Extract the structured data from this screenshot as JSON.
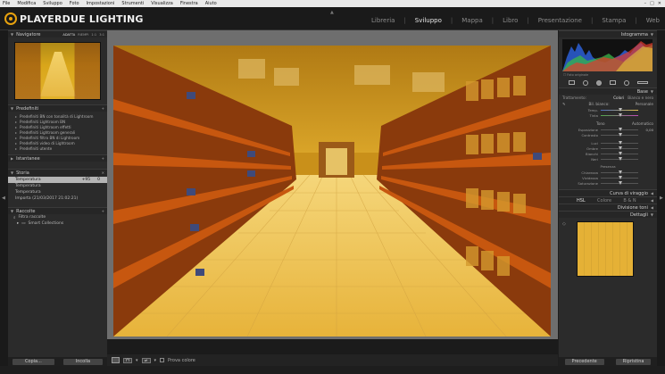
{
  "menubar": {
    "items": [
      "File",
      "Modifica",
      "Sviluppo",
      "Foto",
      "Impostazioni",
      "Strumenti",
      "Visualizza",
      "Finestra",
      "Aiuto"
    ]
  },
  "logo": {
    "text": "PLAYERDUE LIGHTING"
  },
  "modules": {
    "items": [
      "Libreria",
      "Sviluppo",
      "Mappa",
      "Libro",
      "Presentazione",
      "Stampa",
      "Web"
    ],
    "active": "Sviluppo"
  },
  "navigator": {
    "title": "Navigatore",
    "zoom_options": [
      "ADATTA",
      "RIEMPI",
      "1:1",
      "3:1"
    ]
  },
  "presets": {
    "title": "Predefiniti",
    "items": [
      "Predefiniti BN con tonalità di Lightroom",
      "Predefiniti Lightroom BN",
      "Predefiniti Lightroom effetti",
      "Predefiniti Lightroom generali",
      "Predefiniti filtro BN di Lightroom",
      "Predefiniti video di Lightroom",
      "Predefiniti utente"
    ]
  },
  "snapshots": {
    "title": "Istantanee"
  },
  "history": {
    "title": "Storia",
    "items": [
      {
        "label": "Temperatura",
        "value": "+95",
        "value2": "0"
      },
      {
        "label": "Temperatura",
        "value": "",
        "value2": ""
      },
      {
        "label": "Temperatura",
        "value": "",
        "value2": ""
      },
      {
        "label": "Importa (21/03/2017 21:02:21)",
        "value": "",
        "value2": ""
      }
    ]
  },
  "collections": {
    "title": "Raccolte",
    "items": [
      "Filtra raccolte",
      "Smart Collections"
    ]
  },
  "left_buttons": {
    "copy": "Copia...",
    "paste": "Incolla"
  },
  "toolbar": {
    "softproof": "Prova colore"
  },
  "right": {
    "histogram_title": "Istogramma",
    "original_photo": "Foto originale",
    "basic_title": "Base",
    "treatment_label": "Trattamento:",
    "treatment_color": "Colori",
    "treatment_bw": "Bianco e nero",
    "wb_label": "Bil. bianco:",
    "wb_value": "Personale",
    "temp": "Temp.",
    "tint": "Tinta",
    "tone_label": "Tono",
    "tone_auto": "Automatico",
    "exposure": "Esposizione",
    "exposure_value": "0,00",
    "contrast": "Contrasto",
    "highlights": "Luci",
    "shadows": "Ombre",
    "whites": "Bianchi",
    "blacks": "Neri",
    "presence_label": "Presenza",
    "clarity": "Chiarezza",
    "vibrance": "Vividezza",
    "saturation": "Saturazione",
    "tone_curve": "Curva di viraggio",
    "hsl_title": "HSL",
    "hsl_color": "Colore",
    "hsl_bw": "B & N",
    "split_toning": "Divisione toni",
    "detail": "Dettagli"
  },
  "right_buttons": {
    "previous": "Precedente",
    "reset": "Ripristina"
  },
  "colors": {
    "accent": "#e8a20e",
    "photo_tint": "#e0a72a"
  }
}
